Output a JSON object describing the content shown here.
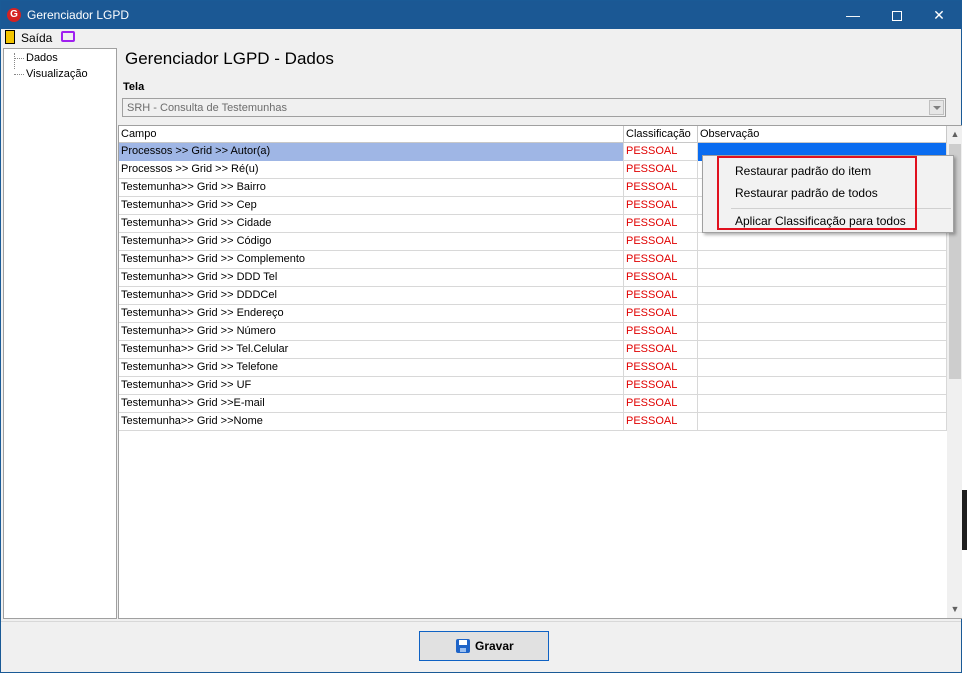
{
  "window": {
    "title": "Gerenciador LGPD",
    "icon": "app-g-icon",
    "controls": {
      "minimize": "—",
      "close": "✕"
    }
  },
  "toolbar": {
    "exit_label": "Saída",
    "exit_icon": "door-exit-icon",
    "screen_icon": "monitor-icon"
  },
  "tree": {
    "items": [
      {
        "label": "Dados"
      },
      {
        "label": "Visualização"
      }
    ]
  },
  "main": {
    "heading": "Gerenciador LGPD - Dados",
    "tela_label": "Tela",
    "tela_value": "SRH - Consulta de Testemunhas"
  },
  "grid": {
    "columns": [
      "Campo",
      "Classificação",
      "Observação"
    ],
    "rows": [
      {
        "campo": "Processos >> Grid >> Autor(a)",
        "classificacao": "PESSOAL",
        "observacao": ""
      },
      {
        "campo": "Processos >> Grid >> Ré(u)",
        "classificacao": "PESSOAL",
        "observacao": ""
      },
      {
        "campo": "Testemunha>> Grid >> Bairro",
        "classificacao": "PESSOAL",
        "observacao": ""
      },
      {
        "campo": "Testemunha>> Grid >> Cep",
        "classificacao": "PESSOAL",
        "observacao": ""
      },
      {
        "campo": "Testemunha>> Grid >> Cidade",
        "classificacao": "PESSOAL",
        "observacao": ""
      },
      {
        "campo": "Testemunha>> Grid >> Código",
        "classificacao": "PESSOAL",
        "observacao": ""
      },
      {
        "campo": "Testemunha>> Grid >> Complemento",
        "classificacao": "PESSOAL",
        "observacao": ""
      },
      {
        "campo": "Testemunha>> Grid >> DDD Tel",
        "classificacao": "PESSOAL",
        "observacao": ""
      },
      {
        "campo": "Testemunha>> Grid >> DDDCel",
        "classificacao": "PESSOAL",
        "observacao": ""
      },
      {
        "campo": "Testemunha>> Grid >> Endereço",
        "classificacao": "PESSOAL",
        "observacao": ""
      },
      {
        "campo": "Testemunha>> Grid >> Número",
        "classificacao": "PESSOAL",
        "observacao": ""
      },
      {
        "campo": "Testemunha>> Grid >> Tel.Celular",
        "classificacao": "PESSOAL",
        "observacao": ""
      },
      {
        "campo": "Testemunha>> Grid >> Telefone",
        "classificacao": "PESSOAL",
        "observacao": ""
      },
      {
        "campo": "Testemunha>> Grid >> UF",
        "classificacao": "PESSOAL",
        "observacao": ""
      },
      {
        "campo": "Testemunha>> Grid >>E-mail",
        "classificacao": "PESSOAL",
        "observacao": ""
      },
      {
        "campo": "Testemunha>> Grid >>Nome",
        "classificacao": "PESSOAL",
        "observacao": ""
      }
    ]
  },
  "context_menu": {
    "items": [
      "Restaurar padrão do item",
      "Restaurar padrão de todos",
      "Aplicar Classificação para todos"
    ]
  },
  "footer": {
    "save_label": "Gravar",
    "save_icon": "floppy-disk-icon"
  },
  "colors": {
    "titlebar": "#1b5894",
    "classification_text": "#e00000",
    "selected_row": "#9fb6e5",
    "selected_cell": "#0a6cf0",
    "highlight_box": "#e0101e"
  }
}
